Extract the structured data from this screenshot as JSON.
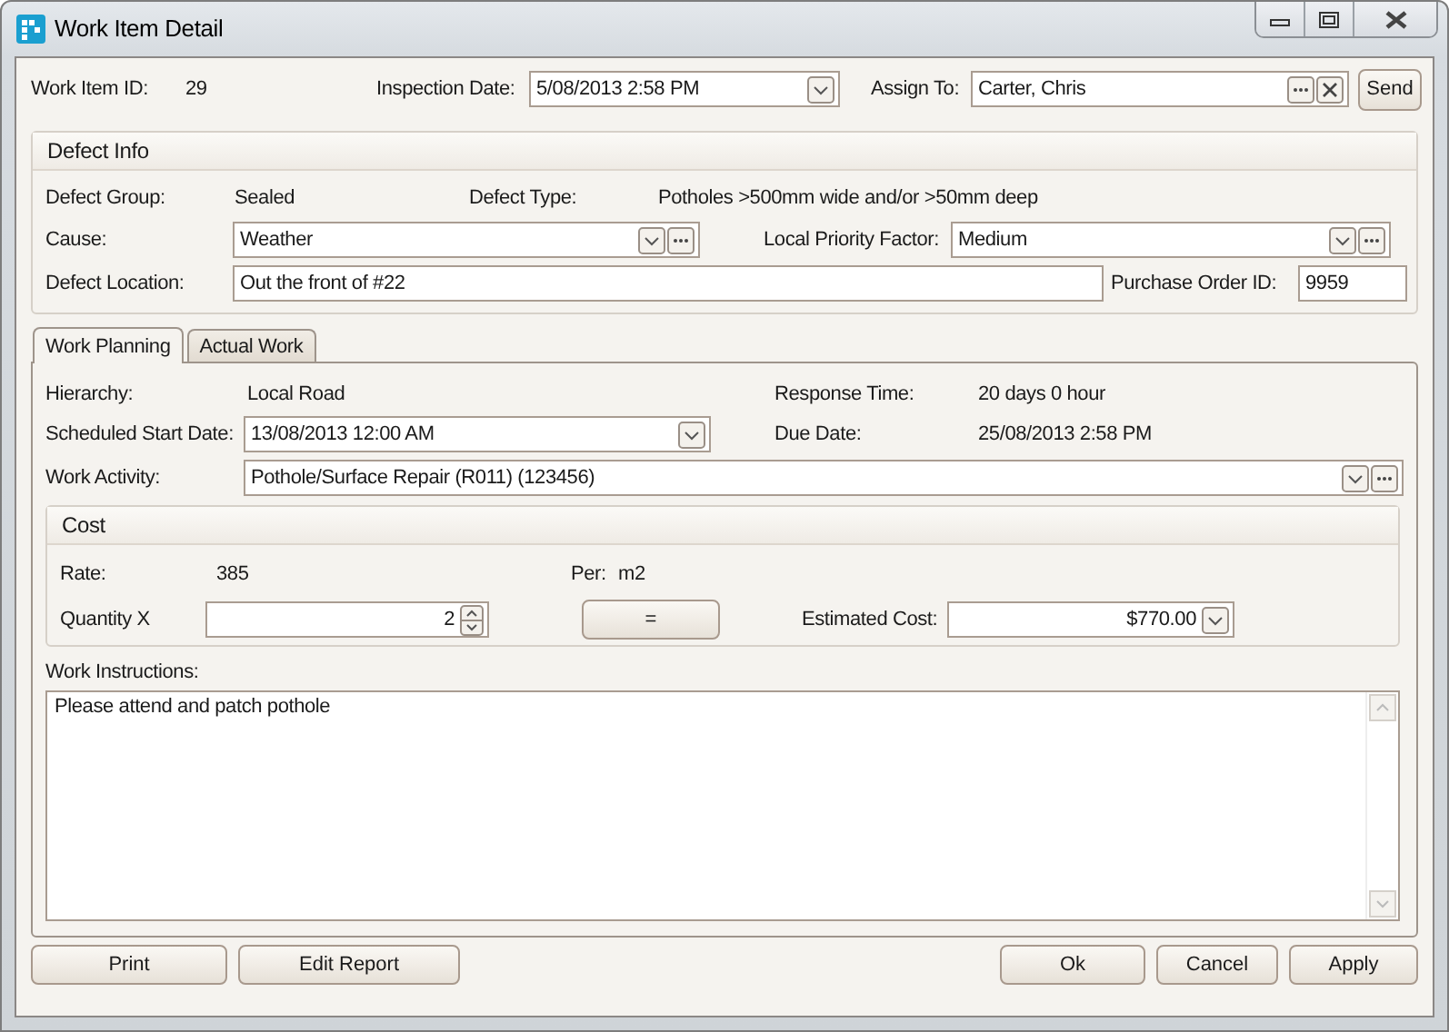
{
  "window": {
    "title": "Work Item Detail"
  },
  "header": {
    "work_item_id": {
      "label": "Work Item ID:",
      "value": "29"
    },
    "inspection_date": {
      "label": "Inspection Date:",
      "value": "5/08/2013 2:58 PM"
    },
    "assign_to": {
      "label": "Assign To:",
      "value": "Carter, Chris"
    },
    "send_button": "Send"
  },
  "defect_info": {
    "title": "Defect Info",
    "defect_group": {
      "label": "Defect Group:",
      "value": "Sealed"
    },
    "defect_type": {
      "label": "Defect Type:",
      "value": "Potholes >500mm wide and/or >50mm deep"
    },
    "cause": {
      "label": "Cause:",
      "value": "Weather"
    },
    "local_priority_factor": {
      "label": "Local Priority Factor:",
      "value": "Medium"
    },
    "defect_location": {
      "label": "Defect Location:",
      "value": "Out the front of #22"
    },
    "purchase_order_id": {
      "label": "Purchase Order ID:",
      "value": "9959"
    }
  },
  "tabs": [
    {
      "label": "Work Planning",
      "selected": true
    },
    {
      "label": "Actual Work",
      "selected": false
    }
  ],
  "work_planning": {
    "hierarchy": {
      "label": "Hierarchy:",
      "value": "Local Road"
    },
    "response_time": {
      "label": "Response Time:",
      "value": "20 days 0 hour"
    },
    "scheduled_start_date": {
      "label": "Scheduled Start Date:",
      "value": "13/08/2013 12:00 AM"
    },
    "due_date": {
      "label": "Due Date:",
      "value": "25/08/2013 2:58 PM"
    },
    "work_activity": {
      "label": "Work Activity:",
      "value": "Pothole/Surface Repair (R011) (123456)"
    }
  },
  "cost": {
    "title": "Cost",
    "rate": {
      "label": "Rate:",
      "value": "385"
    },
    "per": {
      "label": "Per:",
      "value": "m2"
    },
    "quantity": {
      "label": "Quantity X",
      "value": "2"
    },
    "equals_button": "=",
    "estimated_cost": {
      "label": "Estimated Cost:",
      "value": "$770.00"
    }
  },
  "work_instructions": {
    "label": "Work Instructions:",
    "value": "Please attend and patch pothole"
  },
  "buttons": {
    "left": [
      "Print",
      "Edit Report"
    ],
    "right": [
      "Ok",
      "Cancel",
      "Apply"
    ]
  }
}
